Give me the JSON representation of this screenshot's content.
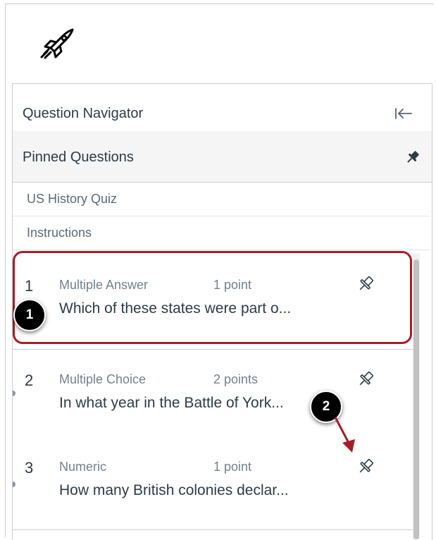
{
  "app": {
    "logo_icon": "rocket-icon"
  },
  "navigator": {
    "title": "Question Navigator",
    "collapse_icon": "collapse-left-icon",
    "pinned_title": "Pinned Questions",
    "pinned_icon": "pin-icon"
  },
  "links": [
    {
      "label": "US History Quiz"
    },
    {
      "label": "Instructions"
    }
  ],
  "questions": [
    {
      "number": "1",
      "type": "Multiple Answer",
      "points": "1 point",
      "text": "Which of these states were part o...",
      "pin_icon": "pin-outline-icon"
    },
    {
      "number": "2",
      "type": "Multiple Choice",
      "points": "2 points",
      "text": "In what year in the Battle of York...",
      "pin_icon": "pin-outline-icon"
    },
    {
      "number": "3",
      "type": "Numeric",
      "points": "1 point",
      "text": "How many British colonies declar...",
      "pin_icon": "pin-outline-icon"
    }
  ],
  "callouts": [
    {
      "number": "1"
    },
    {
      "number": "2"
    }
  ],
  "colors": {
    "highlight": "#a41e28",
    "text": "#2d3b45",
    "muted": "#73818c",
    "header_bg": "#f5f5f5"
  }
}
